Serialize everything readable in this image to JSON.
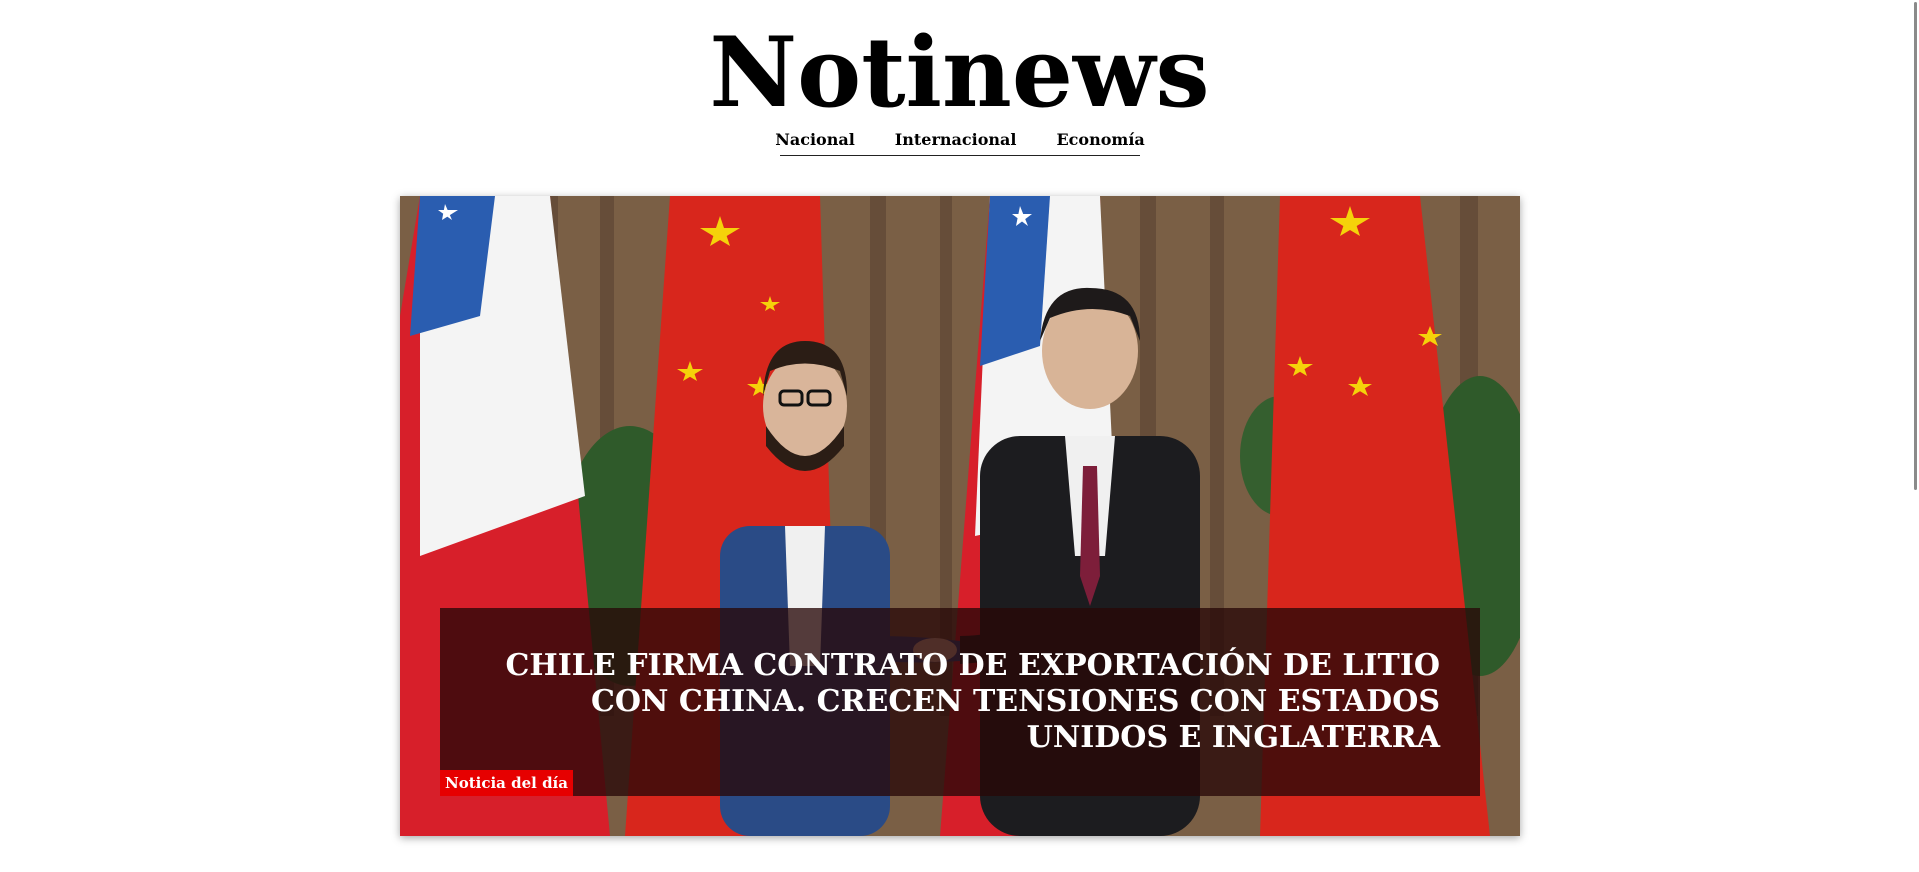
{
  "site": {
    "logo": "Notinews"
  },
  "nav": {
    "items": [
      "Nacional",
      "Internacional",
      "Economía"
    ]
  },
  "hero": {
    "headline": "CHILE FIRMA CONTRATO DE EXPORTACIÓN DE LITIO CON CHINA. CRECEN TENSIONES CON ESTADOS UNIDOS E INGLATERRA",
    "badge": "Noticia del día",
    "badge_color": "#e60000",
    "image_subject": "handshake between two leaders in front of Chilean and Chinese flags"
  }
}
